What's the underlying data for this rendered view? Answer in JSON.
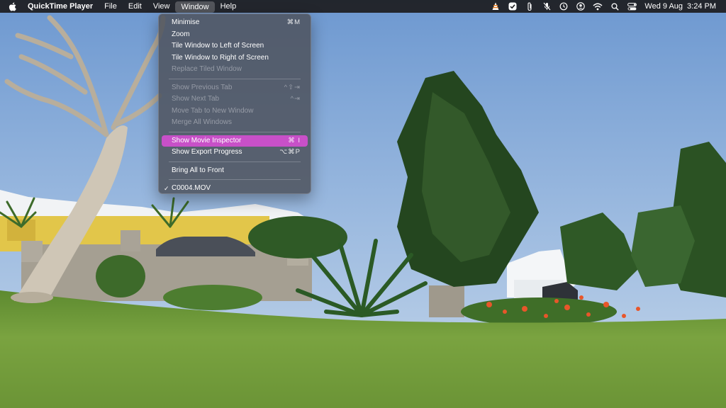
{
  "menubar": {
    "apple_icon": "apple-logo-icon",
    "app_name": "QuickTime Player",
    "menus": [
      "File",
      "Edit",
      "View",
      "Window",
      "Help"
    ],
    "active_menu": "Window",
    "status_icons": [
      "vlc-cone-icon",
      "checkmark-circle-icon",
      "paperclip-icon",
      "microphone-muted-icon",
      "clock-history-icon",
      "user-circle-icon",
      "wifi-icon",
      "search-icon",
      "control-center-icon"
    ],
    "clock": {
      "date": "Wed 9 Aug",
      "time": "3:24 PM"
    }
  },
  "window_menu": {
    "items": [
      {
        "label": "Minimise",
        "shortcut": "⌘M",
        "enabled": true
      },
      {
        "label": "Zoom",
        "shortcut": "",
        "enabled": true
      },
      {
        "label": "Tile Window to Left of Screen",
        "shortcut": "",
        "enabled": true
      },
      {
        "label": "Tile Window to Right of Screen",
        "shortcut": "",
        "enabled": true
      },
      {
        "label": "Replace Tiled Window",
        "shortcut": "",
        "enabled": false
      },
      {
        "label": "Show Previous Tab",
        "shortcut": "^⇧⇥",
        "enabled": false
      },
      {
        "label": "Show Next Tab",
        "shortcut": "^⇥",
        "enabled": false
      },
      {
        "label": "Move Tab to New Window",
        "shortcut": "",
        "enabled": false
      },
      {
        "label": "Merge All Windows",
        "shortcut": "",
        "enabled": false
      },
      {
        "label": "Show Movie Inspector",
        "shortcut": "⌘ I",
        "enabled": true,
        "highlighted": true
      },
      {
        "label": "Show Export Progress",
        "shortcut": "⌥⌘P",
        "enabled": true
      },
      {
        "label": "Bring All to Front",
        "shortcut": "",
        "enabled": true
      },
      {
        "label": "C0004.MOV",
        "shortcut": "",
        "enabled": true,
        "checked": true
      }
    ]
  },
  "colors": {
    "menubar_bg": "#1c1c1e",
    "highlight": "#c850c8",
    "sky": "#7fa6d6",
    "grass": "#6f9a3c"
  }
}
